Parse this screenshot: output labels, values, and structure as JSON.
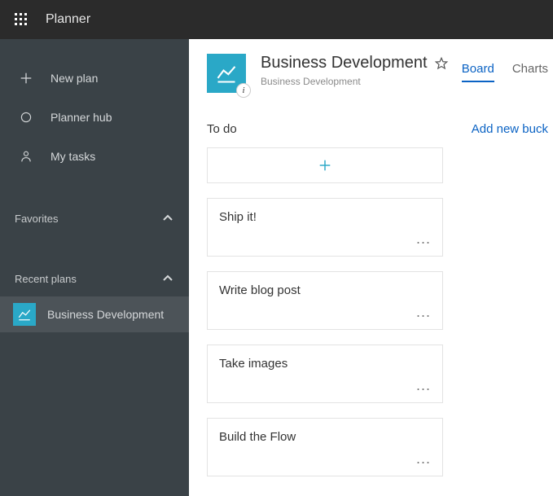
{
  "topbar": {
    "app_name": "Planner"
  },
  "sidebar": {
    "nav": {
      "new_plan": "New plan",
      "planner_hub": "Planner hub",
      "my_tasks": "My tasks"
    },
    "favorites_label": "Favorites",
    "recent_label": "Recent plans",
    "recent": [
      {
        "name": "Business Development"
      }
    ]
  },
  "plan": {
    "title": "Business Development",
    "subtitle": "Business Development"
  },
  "tabs": {
    "board": "Board",
    "charts": "Charts"
  },
  "bucket": {
    "title": "To do",
    "add_new": "Add new buck"
  },
  "tasks": [
    {
      "title": "Ship it!"
    },
    {
      "title": "Write blog post"
    },
    {
      "title": "Take images"
    },
    {
      "title": "Build the Flow"
    }
  ],
  "glyphs": {
    "more": "..."
  }
}
